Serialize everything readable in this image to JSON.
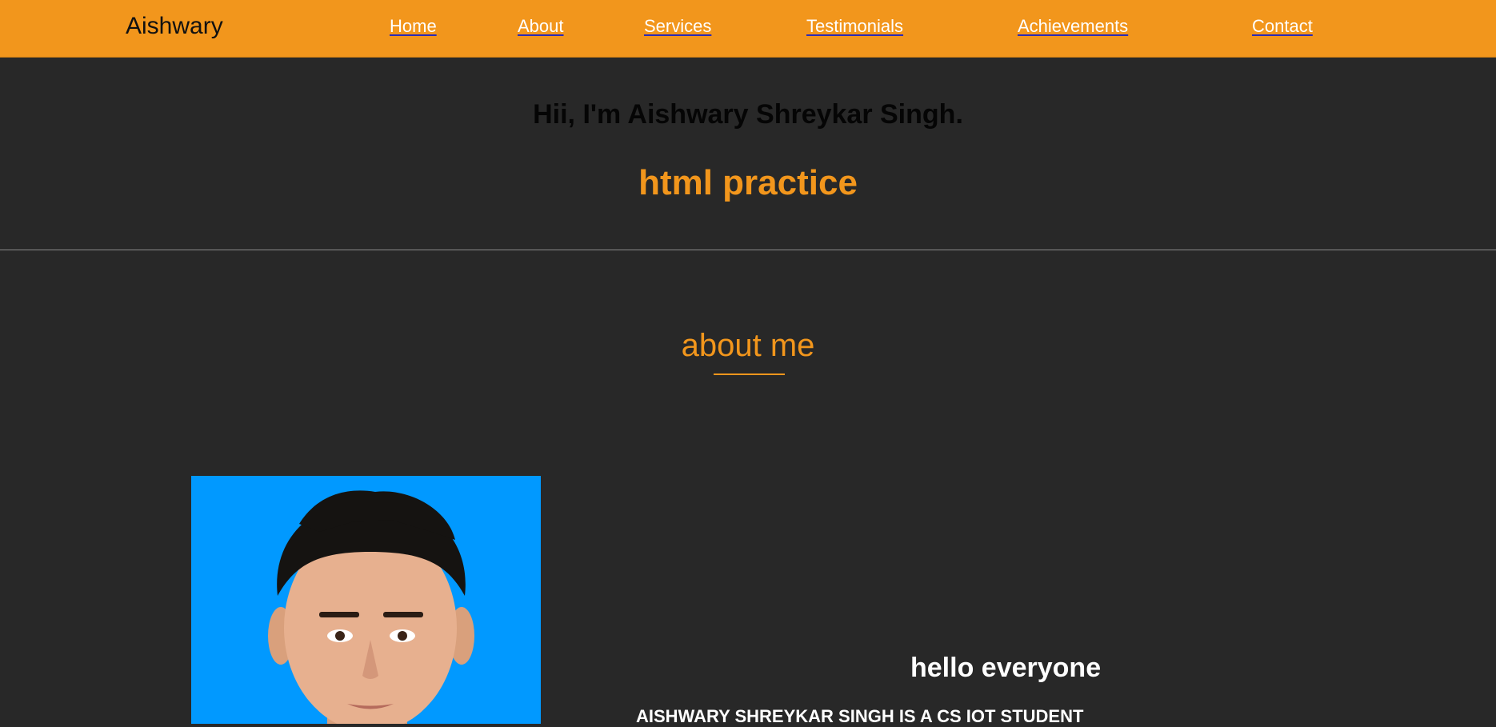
{
  "navbar": {
    "brand": "Aishwary",
    "links": [
      {
        "label": "Home"
      },
      {
        "label": "About"
      },
      {
        "label": "Services"
      },
      {
        "label": "Testimonials"
      },
      {
        "label": "Achievements"
      },
      {
        "label": "Contact"
      }
    ],
    "colors": {
      "background": "#f2961c",
      "link": "#ffffff",
      "underline": "#2b2bb8"
    }
  },
  "hero": {
    "greeting": "Hii, I'm Aishwary Shreykar Singh.",
    "tagline": "html practice"
  },
  "about": {
    "heading": "about me",
    "photo_icon": "profile-photo",
    "hello": "hello everyone",
    "text": "AISHWARY SHREYKAR SINGH IS A CS IOT STUDENT"
  },
  "colors": {
    "page_background": "#282828",
    "accent": "#f2961c",
    "photo_background": "#0199ff"
  }
}
